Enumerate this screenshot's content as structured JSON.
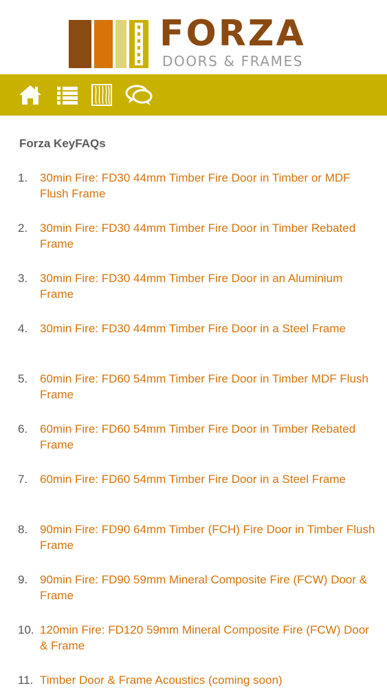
{
  "brand": {
    "name": "FORZA",
    "tagline": "DOORS & FRAMES",
    "colors": {
      "brown": "#8a4a12",
      "orange": "#d7730a",
      "gold": "#c9b100",
      "grey": "#9a9a9a"
    }
  },
  "nav": {
    "background": "#c9b100",
    "items": [
      {
        "icon": "home-icon"
      },
      {
        "icon": "list-icon"
      },
      {
        "icon": "door-grain-icon"
      },
      {
        "icon": "chat-bubbles-icon"
      }
    ]
  },
  "faq": {
    "heading": "Forza KeyFAQs",
    "items": [
      {
        "number": "1.",
        "text": "30min Fire: FD30 44mm Timber Fire Door in Timber or MDF Flush Frame"
      },
      {
        "number": "2.",
        "text": "30min Fire: FD30 44mm Timber Fire Door in Timber Rebated Frame"
      },
      {
        "number": "3.",
        "text": "30min Fire: FD30 44mm Timber Fire Door in an Aluminium Frame"
      },
      {
        "number": "4.",
        "text": "30min Fire: FD30 44mm Timber Fire Door in a Steel Frame"
      },
      {
        "number": "5.",
        "text": "60min Fire: FD60 54mm Timber Fire Door in Timber MDF Flush Frame"
      },
      {
        "number": "6.",
        "text": "60min Fire: FD60 54mm Timber Fire Door in Timber Rebated Frame"
      },
      {
        "number": "7.",
        "text": "60min Fire: FD60 54mm Timber Fire Door in a Steel Frame"
      },
      {
        "number": "8.",
        "text": "90min Fire: FD90 64mm Timber (FCH) Fire Door in Timber Flush Frame"
      },
      {
        "number": "9.",
        "text": "90min Fire: FD90 59mm Mineral Composite Fire (FCW) Door & Frame"
      },
      {
        "number": "10.",
        "text": "120min Fire: FD120 59mm Mineral Composite Fire (FCW) Door & Frame"
      },
      {
        "number": "11.",
        "text": "Timber Door & Frame Acoustics (coming soon)"
      }
    ]
  }
}
